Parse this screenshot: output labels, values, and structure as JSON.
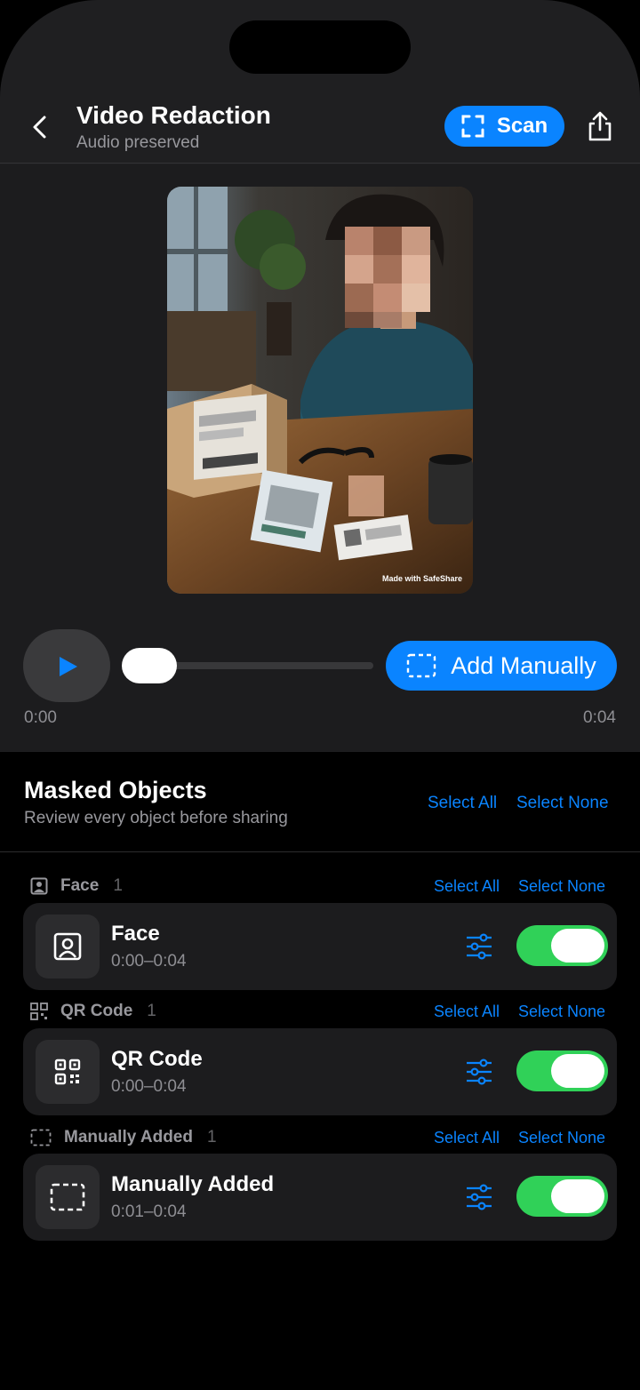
{
  "header": {
    "title": "Video Redaction",
    "subtitle": "Audio preserved",
    "scan_label": "Scan",
    "icons": {
      "back": "chevron-left-icon",
      "scan": "scan-frame-icon",
      "share": "share-icon"
    }
  },
  "preview": {
    "watermark": "Made with SafeShare"
  },
  "playback": {
    "current_time": "0:00",
    "total_time": "0:04",
    "progress": 0.0,
    "add_manually_label": "Add Manually"
  },
  "masked": {
    "title": "Masked Objects",
    "subtitle": "Review every object before sharing",
    "select_all": "Select All",
    "select_none": "Select None",
    "groups": [
      {
        "name": "Face",
        "count": "1",
        "icon": "face-icon",
        "item": {
          "title": "Face",
          "time": "0:00–0:04",
          "enabled": true
        }
      },
      {
        "name": "QR Code",
        "count": "1",
        "icon": "qr-code-icon",
        "item": {
          "title": "QR Code",
          "time": "0:00–0:04",
          "enabled": true
        }
      },
      {
        "name": "Manually Added",
        "count": "1",
        "icon": "dashed-rect-icon",
        "item": {
          "title": "Manually Added",
          "time": "0:01–0:04",
          "enabled": true
        }
      }
    ]
  },
  "colors": {
    "accent": "#0a84ff",
    "toggle_on": "#30d158",
    "background": "#000000",
    "card": "#1c1c1e"
  }
}
